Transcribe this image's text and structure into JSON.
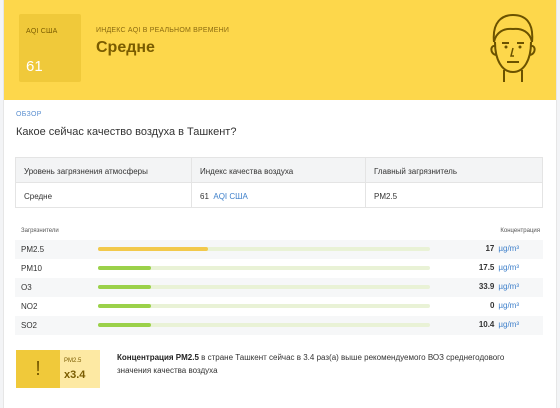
{
  "banner": {
    "aqi_label": "AQI США",
    "aqi_value": "61",
    "realtime_label": "ИНДЕКС AQI В РЕАЛЬНОМ ВРЕМЕНИ",
    "level": "Средне",
    "color": "#fdd74b"
  },
  "overview": {
    "label": "ОБЗОР",
    "question": "Какое сейчас качество воздуха в Ташкент?"
  },
  "table": {
    "headers": [
      "Уровень загрязнения атмосферы",
      "Индекс качества воздуха",
      "Главный загрязнитель"
    ],
    "level": "Средне",
    "aqi_value": "61",
    "aqi_unit": "AQI США",
    "main_pollutant": "PM2.5"
  },
  "pollutants": {
    "header_left": "Загрязнители",
    "header_right": "Концентрация",
    "items": [
      {
        "name": "PM2.5",
        "value": "17",
        "unit": "µg/m³",
        "level": 0.33,
        "color": "#f2c94c"
      },
      {
        "name": "PM10",
        "value": "17.5",
        "unit": "µg/m³",
        "level": 0.16,
        "color": "#9bd14a"
      },
      {
        "name": "O3",
        "value": "33.9",
        "unit": "µg/m³",
        "level": 0.16,
        "color": "#9bd14a"
      },
      {
        "name": "NO2",
        "value": "0",
        "unit": "µg/m³",
        "level": 0.16,
        "color": "#9bd14a"
      },
      {
        "name": "SO2",
        "value": "10.4",
        "unit": "µg/m³",
        "level": 0.16,
        "color": "#9bd14a"
      }
    ]
  },
  "warning": {
    "icon": "exclamation-icon",
    "label": "PM2.5",
    "ratio": "x3.4",
    "text_bold": "Концентрация PM2.5",
    "text_rest": " в стране Ташкент сейчас в 3.4 раз(а) выше рекомендуемого ВОЗ среднегодового значения качества воздуха"
  }
}
